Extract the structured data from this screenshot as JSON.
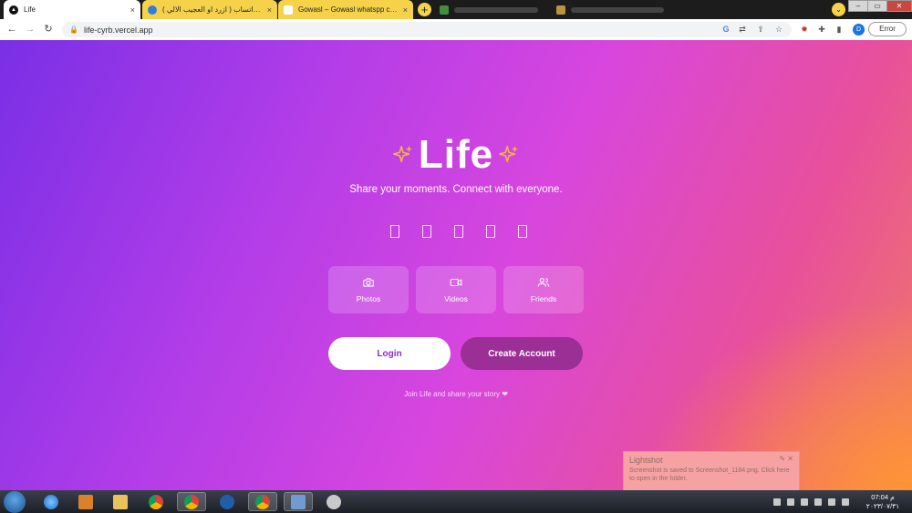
{
  "browser": {
    "tabs": [
      {
        "title": "Life",
        "close": "×"
      },
      {
        "title": "بوت واتساب ( ازرد او العجيب الالي ) Bot",
        "close": "×"
      },
      {
        "title": "Gowasl – Gowasl whatspp chat",
        "close": "×"
      },
      {
        "title": "",
        "close": ""
      },
      {
        "title": "",
        "close": ""
      }
    ],
    "new_tab": "+",
    "tab_search": "⌄",
    "window_controls": {
      "minimize": "–",
      "maximize": "▭",
      "close": "✕"
    },
    "nav": {
      "back": "←",
      "forward": "→",
      "reload": "↻"
    },
    "url": "life-cyrb.vercel.app",
    "profile_initial": "D",
    "error_label": "Error"
  },
  "page": {
    "logo": "Life",
    "tagline": "Share your moments. Connect with everyone.",
    "features": [
      {
        "label": "Photos",
        "icon": "camera-icon"
      },
      {
        "label": "Videos",
        "icon": "video-icon"
      },
      {
        "label": "Friends",
        "icon": "users-icon"
      }
    ],
    "login_label": "Login",
    "create_account_label": "Create Account",
    "join_text": "Join Life and share your story ❤",
    "colors": {
      "sparkle": "#f2b24a",
      "create_button": "#9b2f95",
      "login_text": "#8a2bd0"
    }
  },
  "toast": {
    "title": "Lightshot",
    "message": "Screenshot is saved to Screenshot_1184.png. Click here to open in the folder.",
    "controls": "✎ ✕"
  },
  "taskbar": {
    "time": "07:04 م",
    "date": "٢٠٢٣/٠٧/٣١"
  }
}
